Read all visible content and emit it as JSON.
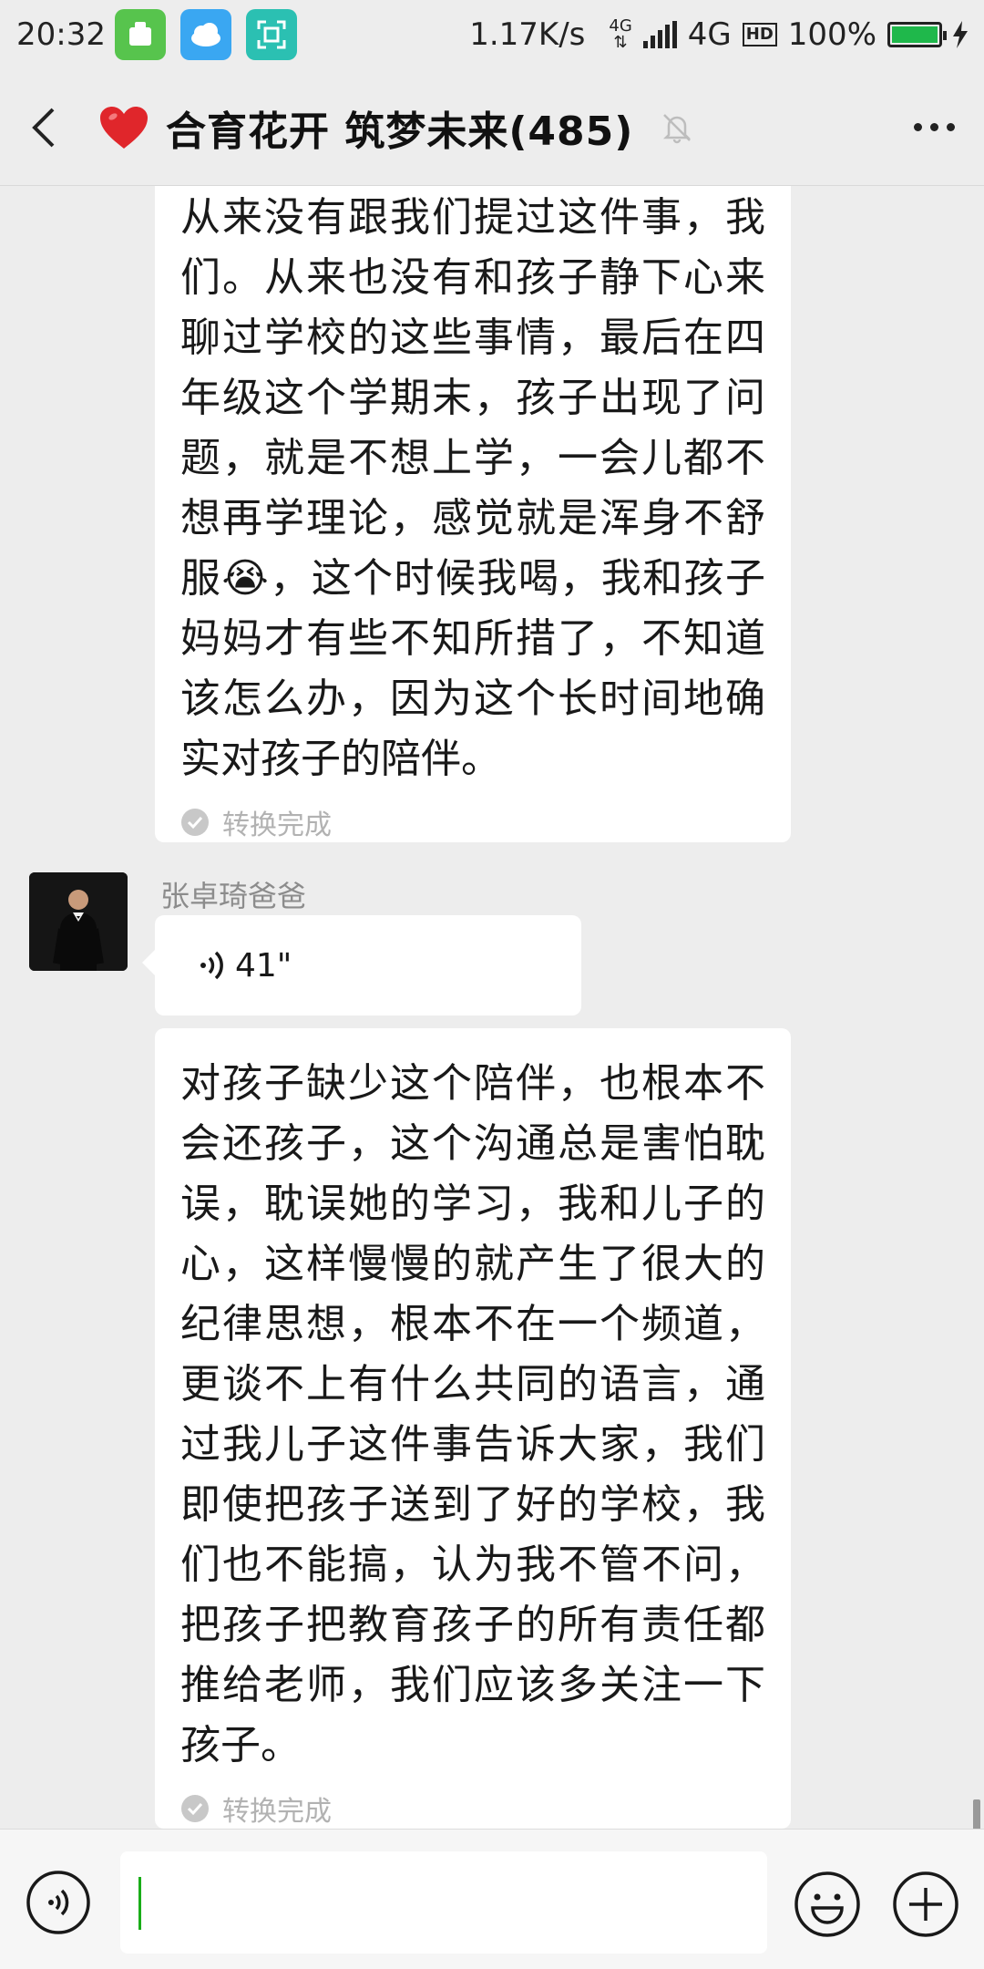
{
  "status_bar": {
    "time": "20:32",
    "net_speed": "1.17K/s",
    "network_small": "4G",
    "network": "4G",
    "hd": "HD",
    "battery": "100%",
    "icons": [
      "clean-app-icon",
      "weather-app-icon",
      "scan-app-icon",
      "signal-icon",
      "battery-icon",
      "charging-icon"
    ]
  },
  "header": {
    "title": "合育花开 筑梦未来(485)",
    "icons": [
      "back-icon",
      "heart-icon",
      "mute-icon",
      "more-icon"
    ]
  },
  "messages": [
    {
      "type": "voice-transcript",
      "text": "从来没有跟我们提过这件事，我们。从来也没有和孩子静下心来聊过学校的这些事情，最后在四年级这个学期末，孩子出现了问题，就是不想上学，一会儿都不想再学理论，感觉就是浑身不舒服😭，这个时候我喝，我和孩子妈妈才有些不知所措了，不知道该怎么办，因为这个长时间地确实对孩子的陪伴。",
      "status": "转换完成"
    },
    {
      "type": "voice",
      "sender": "张卓琦爸爸",
      "duration": "41\""
    },
    {
      "type": "voice-transcript",
      "text": "对孩子缺少这个陪伴，也根本不会还孩子，这个沟通总是害怕耽误，耽误她的学习，我和儿子的心，这样慢慢的就产生了很大的纪律思想，根本不在一个频道，更谈不上有什么共同的语言，通过我儿子这件事告诉大家，我们即使把孩子送到了好的学校，我们也不能搞，认为我不管不问，把孩子把教育孩子的所有责任都推给老师，我们应该多关注一下孩子。",
      "status": "转换完成"
    }
  ],
  "input_bar": {
    "text_value": "",
    "icons": [
      "voice-toggle-icon",
      "emoji-icon",
      "plus-icon"
    ]
  },
  "colors": {
    "background": "#ededed",
    "bubble": "#ffffff",
    "cursor": "#1aad19",
    "muted_text": "#b2b2b2"
  }
}
